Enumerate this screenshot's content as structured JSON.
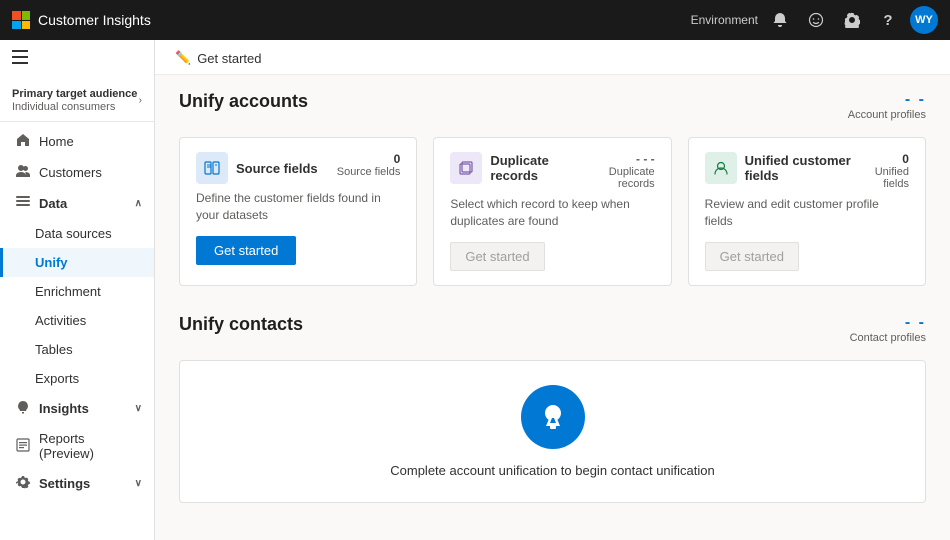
{
  "topnav": {
    "app_name": "Customer Insights",
    "env_label": "Environment",
    "avatar_initials": "WY"
  },
  "sidebar": {
    "hamburger": "☰",
    "primary_audience_label": "Primary target audience",
    "primary_audience_sub": "Individual consumers",
    "nav_items": [
      {
        "id": "home",
        "icon": "🏠",
        "label": "Home",
        "active": false
      },
      {
        "id": "customers",
        "icon": "👥",
        "label": "Customers",
        "active": false
      },
      {
        "id": "data",
        "icon": "📊",
        "label": "Data",
        "active": false,
        "has_caret": true,
        "expanded": true
      },
      {
        "id": "data-sources",
        "icon": "",
        "label": "Data sources",
        "sub": true,
        "active": false
      },
      {
        "id": "unify",
        "icon": "",
        "label": "Unify",
        "sub": true,
        "active": true
      },
      {
        "id": "enrichment",
        "icon": "",
        "label": "Enrichment",
        "sub": true,
        "active": false
      },
      {
        "id": "activities",
        "icon": "",
        "label": "Activities",
        "sub": true,
        "active": false
      },
      {
        "id": "tables",
        "icon": "",
        "label": "Tables",
        "sub": true,
        "active": false
      },
      {
        "id": "exports",
        "icon": "",
        "label": "Exports",
        "sub": true,
        "active": false
      },
      {
        "id": "insights",
        "icon": "💡",
        "label": "Insights",
        "active": false,
        "has_caret": true
      },
      {
        "id": "reports",
        "icon": "📋",
        "label": "Reports (Preview)",
        "active": false
      },
      {
        "id": "settings",
        "icon": "⚙️",
        "label": "Settings",
        "active": false,
        "has_caret": true
      }
    ]
  },
  "breadcrumb": {
    "icon": "✏️",
    "text": "Get started"
  },
  "unify_accounts": {
    "title": "Unify accounts",
    "profile_dashes": "- -",
    "profile_label": "Account profiles",
    "cards": [
      {
        "id": "source-fields",
        "icon": "⊞",
        "icon_type": "blue-light",
        "title": "Source fields",
        "count": "0",
        "count_label": "Source fields",
        "description": "Define the customer fields found in your datasets",
        "action_label": "Get started",
        "action_type": "primary"
      },
      {
        "id": "duplicate-records",
        "icon": "⊟",
        "icon_type": "purple-light",
        "title": "Duplicate records",
        "count": "- - -",
        "count_label": "Duplicate records",
        "description": "Select which record to keep when duplicates are found",
        "action_label": "Get started",
        "action_type": "disabled"
      },
      {
        "id": "unified-customer-fields",
        "icon": "👤",
        "icon_type": "green-light",
        "title": "Unified customer fields",
        "count": "0",
        "count_label": "Unified fields",
        "description": "Review and edit customer profile fields",
        "action_label": "Get started",
        "action_type": "disabled"
      }
    ]
  },
  "unify_contacts": {
    "title": "Unify contacts",
    "profile_dashes": "- -",
    "profile_label": "Contact profiles",
    "empty_icon": "📎",
    "empty_text": "Complete account unification to begin contact unification"
  }
}
